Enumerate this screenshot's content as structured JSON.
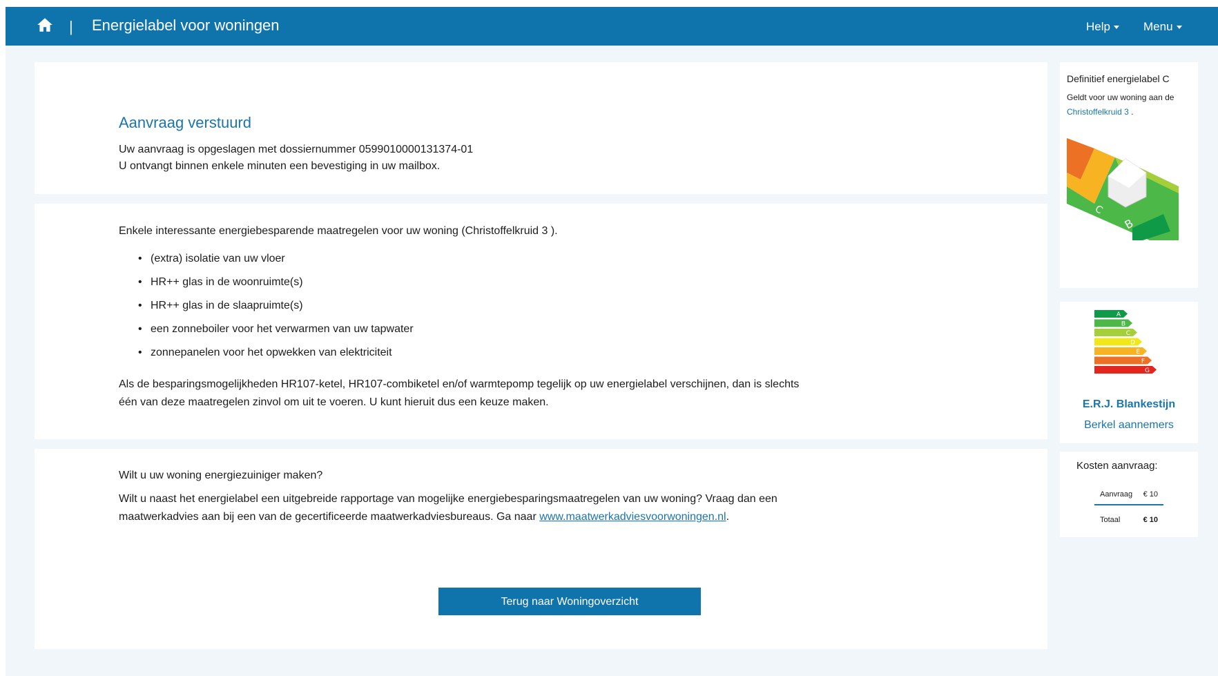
{
  "header": {
    "title": "Energielabel voor woningen",
    "separator": "|",
    "help_label": "Help",
    "menu_label": "Menu",
    "bar_color": "#0f74ac"
  },
  "confirmation": {
    "heading": "Aanvraag verstuurd",
    "line1": "Uw aanvraag is opgeslagen met dossiernummer 0599010000131374-01",
    "line2": "U ontvangt binnen enkele minuten een bevestiging in uw mailbox."
  },
  "measures": {
    "intro": "Enkele interessante energiebesparende maatregelen voor uw woning (Christoffelkruid 3 ).",
    "items": [
      "(extra) isolatie van uw vloer",
      "HR++ glas in de woonruimte(s)",
      "HR++ glas in de slaapruimte(s)",
      "een zonneboiler voor het verwarmen van uw tapwater",
      "zonnepanelen voor het opwekken van elektriciteit"
    ],
    "note": "Als de besparingsmogelijkheden HR107-ketel, HR107-combiketel en/of warmtepomp tegelijk op uw energielabel verschijnen, dan is slechts één van deze maatregelen zinvol om uit te voeren. U kunt hieruit dus een keuze maken."
  },
  "advice": {
    "question": "Wilt u uw woning energiezuiniger maken?",
    "text_before_link": "Wilt u naast het energielabel een uitgebreide rapportage van mogelijke energiebesparingsmaatregelen van uw woning? Vraag dan een maatwerkadvies aan bij een van de gecertificeerde maatwerkadviesbureaus. Ga naar ",
    "link_text": "www.maatwerkadviesvoorwoningen.nl",
    "text_after_link": ".",
    "back_button": "Terug naar Woningoverzicht"
  },
  "sidebar": {
    "label_title": "Definitief energielabel C",
    "label_applies": "Geldt voor uw woning aan de",
    "address_link": "Christoffelkruid 3",
    "address_suffix": " .",
    "label_graphic_letters": [
      "C",
      "B"
    ],
    "label_scale": [
      {
        "letter": "A",
        "color": "#0f9a48"
      },
      {
        "letter": "B",
        "color": "#4cb848"
      },
      {
        "letter": "C",
        "color": "#a4cf3b"
      },
      {
        "letter": "D",
        "color": "#f2e71b"
      },
      {
        "letter": "E",
        "color": "#f8b322"
      },
      {
        "letter": "F",
        "color": "#ec7124"
      },
      {
        "letter": "G",
        "color": "#e2261e"
      }
    ],
    "advisor_name": "E.R.J. Blankestijn",
    "advisor_company": "Berkel aannemers",
    "costs_title": "Kosten aanvraag:",
    "cost_request_label": "Aanvraag",
    "cost_request_value": "€ 10",
    "cost_total_label": "Totaal",
    "cost_total_value": "€ 10"
  }
}
